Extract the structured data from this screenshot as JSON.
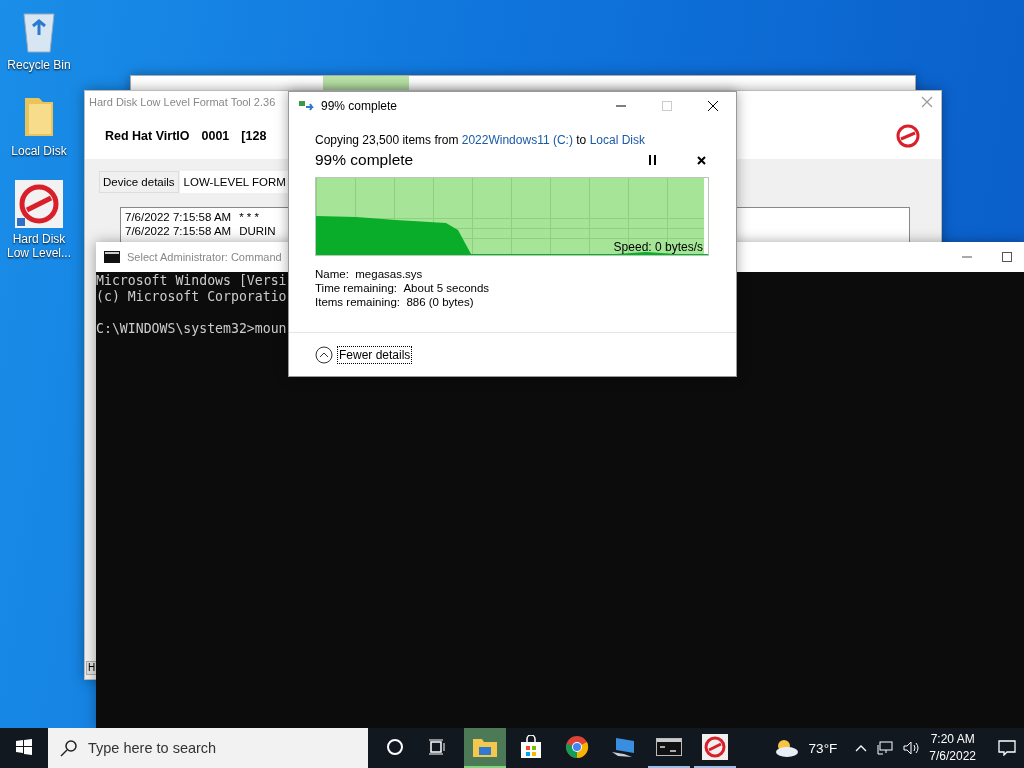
{
  "desktop_icons": [
    {
      "kind": "recycle",
      "lines": [
        "Recycle Bin"
      ]
    },
    {
      "kind": "folder",
      "lines": [
        "Local Disk"
      ]
    },
    {
      "kind": "format-app",
      "lines": [
        "Hard Disk",
        "Low Level..."
      ]
    }
  ],
  "format_tool": {
    "title": "Hard Disk Low Level Format Tool 2.36",
    "device": [
      "Red Hat VirtIO",
      "0001",
      "[128"
    ],
    "tabs": [
      {
        "label": "Device details",
        "selected": false
      },
      {
        "label": "LOW-LEVEL FORM",
        "selected": true
      }
    ],
    "log": [
      {
        "time": "7/6/2022 7:15:58 AM",
        "message": "* * *"
      },
      {
        "time": "7/6/2022 7:15:58 AM",
        "message": "DURIN"
      }
    ],
    "footer_button": "H"
  },
  "console": {
    "title": "Select Administrator: Command",
    "lines": [
      "Microsoft Windows [Versi",
      "(c) Microsoft Corporatio"
    ],
    "prompt": "C:\\WINDOWS\\system32>moun"
  },
  "copy_dialog": {
    "title": "99% complete",
    "summary": {
      "prefix": "Copying 23,500 items from",
      "source": "2022Windows11 (C:)",
      "joiner": "to",
      "destination": "Local Disk"
    },
    "heading": "99% complete",
    "progress": {
      "level": 0.99
    },
    "speed": "Speed: 0 bytes/s",
    "details": [
      {
        "label": "Name:",
        "value": "megasas.sys"
      },
      {
        "label": "Time remaining:",
        "value": "About 5 seconds"
      },
      {
        "label": "Items remaining:",
        "value": "886 (0 bytes)"
      }
    ],
    "toggle": {
      "label": "Fewer details",
      "expanded": true
    }
  },
  "taskbar": {
    "search_placeholder": "Type here to search",
    "apps": [
      {
        "kind": "explorer",
        "active": true,
        "running": true
      },
      {
        "kind": "store",
        "active": false,
        "running": false
      },
      {
        "kind": "chrome",
        "active": false,
        "running": false
      },
      {
        "kind": "computer",
        "active": false,
        "running": false
      },
      {
        "kind": "console",
        "active": false,
        "running": true
      },
      {
        "kind": "format-app",
        "active": false,
        "running": true
      }
    ],
    "weather": "73°F",
    "time": "7:20 AM",
    "date": "7/6/2022"
  }
}
